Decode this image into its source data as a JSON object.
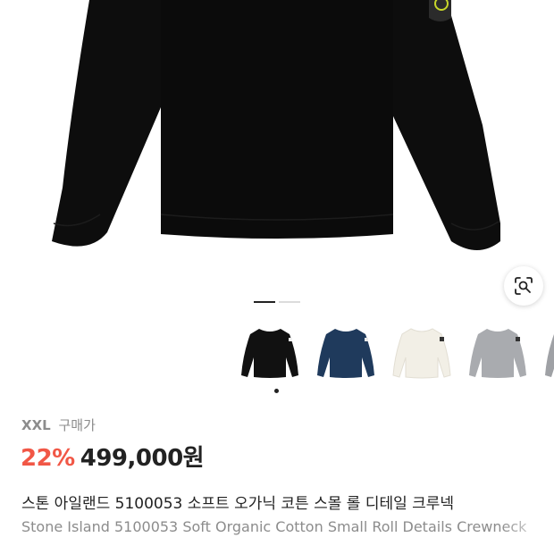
{
  "product": {
    "size_label": "XXL",
    "price_type_label": "구매가",
    "discount": "22%",
    "price": "499,000원",
    "title_ko": "스톤 아일랜드 5100053 소프트 오가닉 코튼 스몰 롤 디테일 크루넥",
    "title_en": "Stone Island 5100053 Soft Organic Cotton Small Roll Details Crewneck"
  },
  "gallery": {
    "page_count": 2,
    "active_page": 1,
    "lens_icon": "lens-search-icon"
  },
  "colors": {
    "accent_discount": "#f15746",
    "text_primary": "#222222",
    "text_secondary": "#8c8c8c",
    "swatches": [
      "#111111",
      "#1f3a5c",
      "#f2efe6",
      "#a9abaf",
      "#9fa1a5"
    ]
  },
  "thumbnails": [
    {
      "name": "black crewneck",
      "selected": true
    },
    {
      "name": "navy crewneck",
      "selected": false
    },
    {
      "name": "cream crewneck",
      "selected": false
    },
    {
      "name": "grey crewneck",
      "selected": false
    },
    {
      "name": "light grey crewneck",
      "selected": false
    }
  ]
}
